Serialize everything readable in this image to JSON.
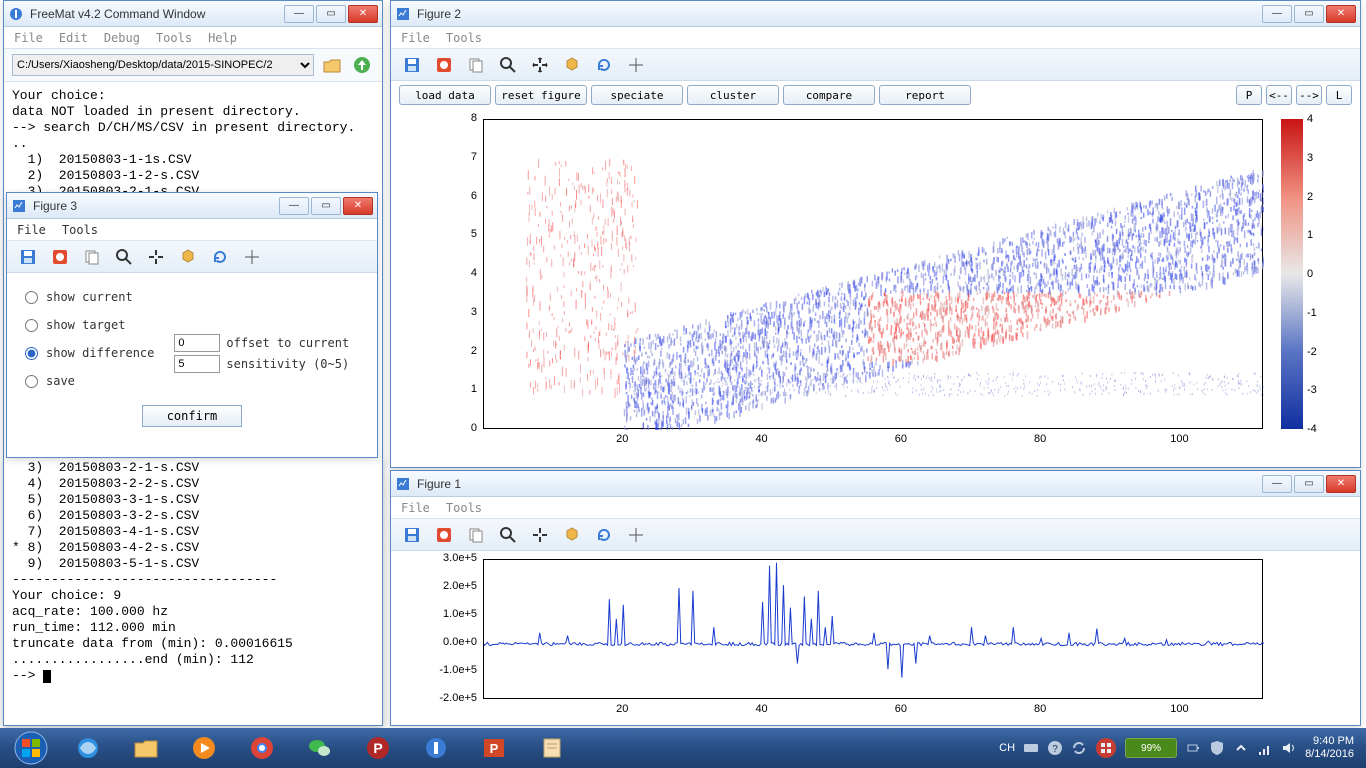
{
  "cmdwin": {
    "title": "FreeMat v4.2 Command Window",
    "menus": [
      "File",
      "Edit",
      "Debug",
      "Tools",
      "Help"
    ],
    "path": "C:/Users/Xiaosheng/Desktop/data/2015-SINOPEC/2",
    "console_top": "Your choice:\ndata NOT loaded in present directory.\n--> search D/CH/MS/CSV in present directory.\n..\n  1)  20150803-1-1s.CSV\n  2)  20150803-1-2-s.CSV\n  3)  20150803-2-1-s.CSV",
    "console_bottom": "  3)  20150803-2-1-s.CSV\n  4)  20150803-2-2-s.CSV\n  5)  20150803-3-1-s.CSV\n  6)  20150803-3-2-s.CSV\n  7)  20150803-4-1-s.CSV\n* 8)  20150803-4-2-s.CSV\n  9)  20150803-5-1-s.CSV\n----------------------------------\nYour choice: 9\nacq_rate: 100.000 hz\nrun_time: 112.000 min\ntruncate data from (min): 0.00016615\n.................end (min): 112\n--> "
  },
  "fig3": {
    "title": "Figure 3",
    "menus": [
      "File",
      "Tools"
    ],
    "radios": {
      "current": "show current",
      "target": "show target",
      "diff": "show difference",
      "save": "save"
    },
    "offset_val": "0",
    "sens_val": "5",
    "offset_lbl": "offset to current",
    "sens_lbl": "sensitivity (0~5)",
    "confirm": "confirm"
  },
  "fig2": {
    "title": "Figure 2",
    "menus": [
      "File",
      "Tools"
    ],
    "buttons": [
      "load data",
      "reset figure",
      "speciate",
      "cluster",
      "compare",
      "report"
    ],
    "navbtns": [
      "P",
      "<--",
      "-->",
      "L"
    ]
  },
  "fig1": {
    "title": "Figure 1",
    "menus": [
      "File",
      "Tools"
    ]
  },
  "chart_data": [
    {
      "id": "figure2_density",
      "type": "heatmap",
      "xlabel": "",
      "ylabel": "",
      "xlim": [
        0,
        112
      ],
      "ylim": [
        0,
        8
      ],
      "colorbar": {
        "min": -4,
        "max": 4,
        "ticks": [
          -4,
          -3,
          -2,
          -1,
          0,
          1,
          2,
          3,
          4
        ]
      },
      "x_ticks": [
        20,
        40,
        60,
        80,
        100
      ],
      "y_ticks": [
        0,
        1,
        2,
        3,
        4,
        5,
        6,
        7,
        8
      ],
      "note": "2D point cloud: red positive cluster roughly x∈[6,20] y∈[1,7] vertical streaks; blue/mixed broad band rising from y≈1 at x=20 to y≈6.5 at x=110 thickness ~2.5, with red sub-band y≈2–3.5 for x∈[60,100]; faint lower blue trail y≈1–1.5 across full x."
    },
    {
      "id": "figure1_trace",
      "type": "line",
      "xlabel": "",
      "ylabel": "",
      "xlim": [
        0,
        112
      ],
      "ylim": [
        -200000,
        300000
      ],
      "x_ticks": [
        20,
        40,
        60,
        80,
        100
      ],
      "y_ticks": [
        -200000,
        -100000,
        0,
        100000,
        200000,
        300000
      ],
      "y_tick_labels": [
        "-2.0e+5",
        "-1.0e+5",
        "0.0e+0",
        "1.0e+5",
        "2.0e+5",
        "3.0e+5"
      ],
      "note": "noisy baseline near 0 across full range; sparse spikes up to ~1.6e5 around x≈20; pair of spikes ~2.0e5 at x≈28–30; dense spike group x≈40–50 peaking ~2.9e5 at x≈42 with a dip to ~-0.7e5; moderate dips to ~-1.2e5 around x≈58–62; small spikes ~0.6e5 at x≈70,76,88; activity decays after x≈95."
    }
  ],
  "taskbar": {
    "lang": "CH",
    "battery": "99%",
    "time": "9:40 PM",
    "date": "8/14/2016"
  }
}
